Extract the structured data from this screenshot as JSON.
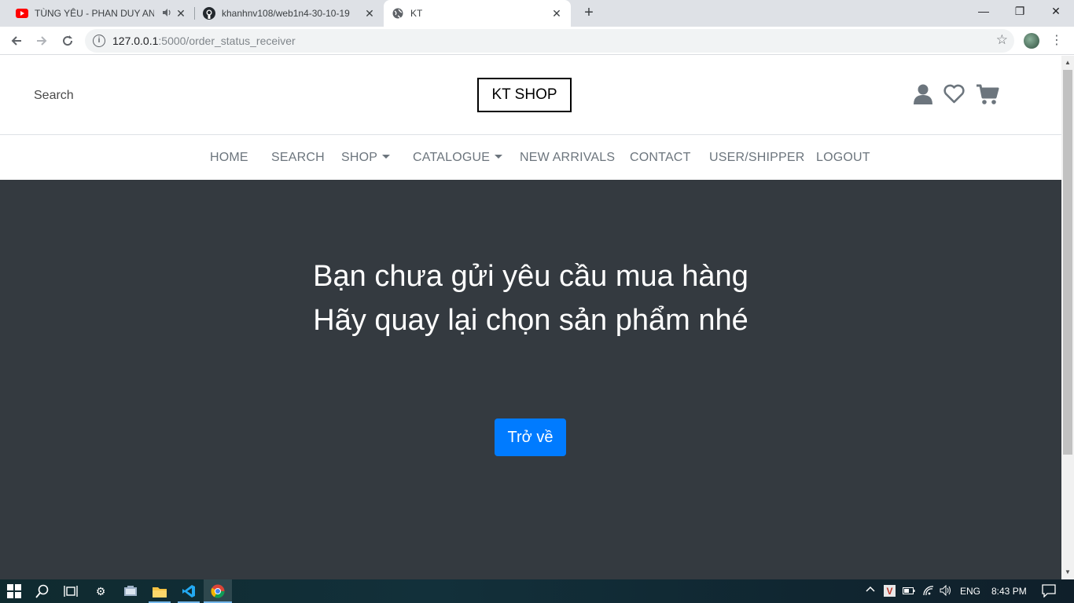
{
  "browser": {
    "tabs": [
      {
        "title": "TÙNG YÊU - PHAN DUY ANH",
        "icon": "youtube-icon",
        "audio": true
      },
      {
        "title": "khanhnv108/web1n4-30-10-19",
        "icon": "github-icon"
      },
      {
        "title": "KT",
        "icon": "globe-icon",
        "active": true
      }
    ],
    "url_host": "127.0.0.1",
    "url_path": ":5000/order_status_receiver"
  },
  "header": {
    "search_label": "Search",
    "logo": "KT SHOP"
  },
  "nav": {
    "items": [
      {
        "label": "HOME"
      },
      {
        "label": "SEARCH"
      },
      {
        "label": "SHOP",
        "dropdown": true
      },
      {
        "label": "CATALOGUE",
        "dropdown": true
      },
      {
        "label": "NEW ARRIVALS"
      },
      {
        "label": "CONTACT"
      },
      {
        "label": "USER/SHIPPER"
      },
      {
        "label": "LOGOUT"
      }
    ]
  },
  "main": {
    "line1": "Bạn chưa gửi yêu cầu mua hàng",
    "line2": "Hãy quay lại chọn sản phẩm nhé",
    "back_button": "Trở về"
  },
  "taskbar": {
    "language": "ENG",
    "time": "8:43 PM"
  },
  "colors": {
    "hero_bg": "#343a40",
    "primary": "#007bff",
    "nav_text": "#6c757d"
  }
}
